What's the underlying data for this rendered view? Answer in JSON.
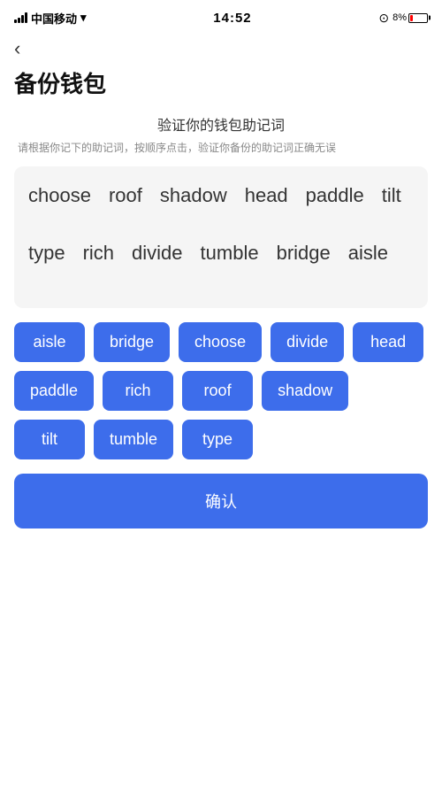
{
  "statusBar": {
    "carrier": "中国移动",
    "time": "14:52",
    "battery": "8%"
  },
  "backButton": {
    "label": "‹"
  },
  "pageTitle": "备份钱包",
  "sectionTitle": "验证你的钱包助记词",
  "sectionDesc": "请根据你记下的助记词，按顺序点击，验证你备份的助记词正确无误",
  "displayWords": [
    "choose",
    "roof",
    "shadow",
    "head",
    "paddle",
    "tilt",
    "type",
    "rich",
    "divide",
    "tumble",
    "bridge",
    "aisle"
  ],
  "wordButtons": [
    "aisle",
    "bridge",
    "choose",
    "divide",
    "head",
    "paddle",
    "rich",
    "roof",
    "shadow",
    "tilt",
    "tumble",
    "type"
  ],
  "confirmButton": "确认"
}
